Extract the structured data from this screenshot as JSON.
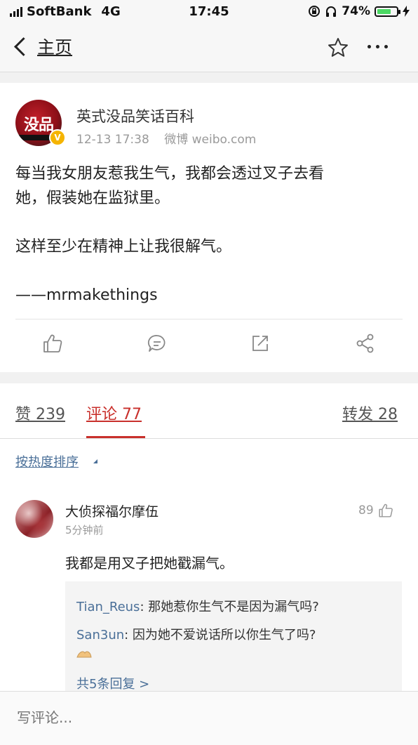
{
  "status_bar": {
    "carrier": "SoftBank",
    "network": "4G",
    "time": "17:45",
    "battery": "74%",
    "battery_level": 0.74
  },
  "nav": {
    "back_label": "主页",
    "icons": [
      "chevron-left-icon",
      "star-icon",
      "more-icon"
    ]
  },
  "post": {
    "author": "英式没品笑话百科",
    "avatar_text": "没品",
    "verified": "V",
    "timestamp": "12-13 17:38",
    "source": "微博 weibo.com",
    "body_line1": "每当我女朋友惹我生气，我都会透过叉子去看",
    "body_line2": "她，假装她在监狱里。",
    "body_line3": "这样至少在精神上让我很解气。",
    "body_line4": "——mrmakethings",
    "actions": [
      "like-icon",
      "comment-icon",
      "share-icon",
      "forward-icon"
    ]
  },
  "tabs": {
    "likes": "赞 239",
    "comments": "评论 77",
    "reposts": "转发 28",
    "active": "comments"
  },
  "sort": {
    "label": "按热度排序"
  },
  "comment": {
    "user": "大侦探福尔摩伍",
    "time": "5分钟前",
    "likes": "89",
    "text": "我都是用叉子把她戳漏气。",
    "replies": [
      {
        "name": "Tian_Reus",
        "text": ": 那她惹你生气不是因为漏气吗?"
      },
      {
        "name": "San3un",
        "text": ": 因为她不爱说话所以你生气了吗?"
      }
    ],
    "more_replies": "共5条回复 >"
  },
  "composer": {
    "placeholder": "写评论..."
  },
  "colors": {
    "accent_red": "#c9302c",
    "link_blue": "#4a6f98",
    "meta_gray": "#9a9a9a"
  }
}
